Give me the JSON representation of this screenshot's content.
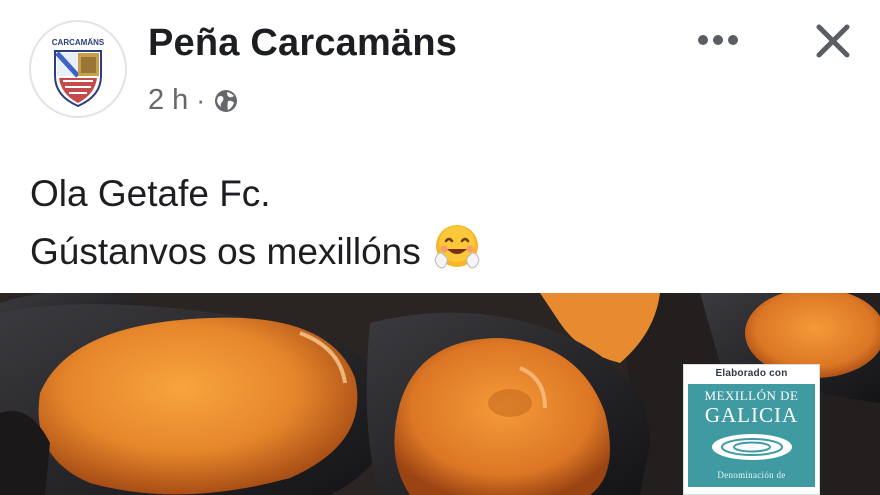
{
  "post": {
    "author": {
      "name": "Peña Carcamäns",
      "avatar_text": "CARCAMÄNS",
      "avatar_icon": "club-crest-icon"
    },
    "meta": {
      "time": "2 h",
      "separator": "·",
      "audience_icon": "globe-icon"
    },
    "actions": {
      "more_icon": "more-horizontal-icon",
      "close_icon": "close-icon"
    },
    "text": {
      "line1": "Ola Getafe Fc.",
      "line2": "Gústanvos os mexillóns",
      "emoji": "hugging-face-emoji"
    },
    "photo": {
      "label_top": "Elaborado con",
      "label_title_1": "MEXILLÓN DE",
      "label_title_2": "GALICIA",
      "label_bottom": "Denominación de"
    }
  },
  "colors": {
    "text_primary": "#1c1e21",
    "text_secondary": "#65676b",
    "label_teal": "#3f9aa2",
    "mussel_orange": "#e6862b"
  }
}
